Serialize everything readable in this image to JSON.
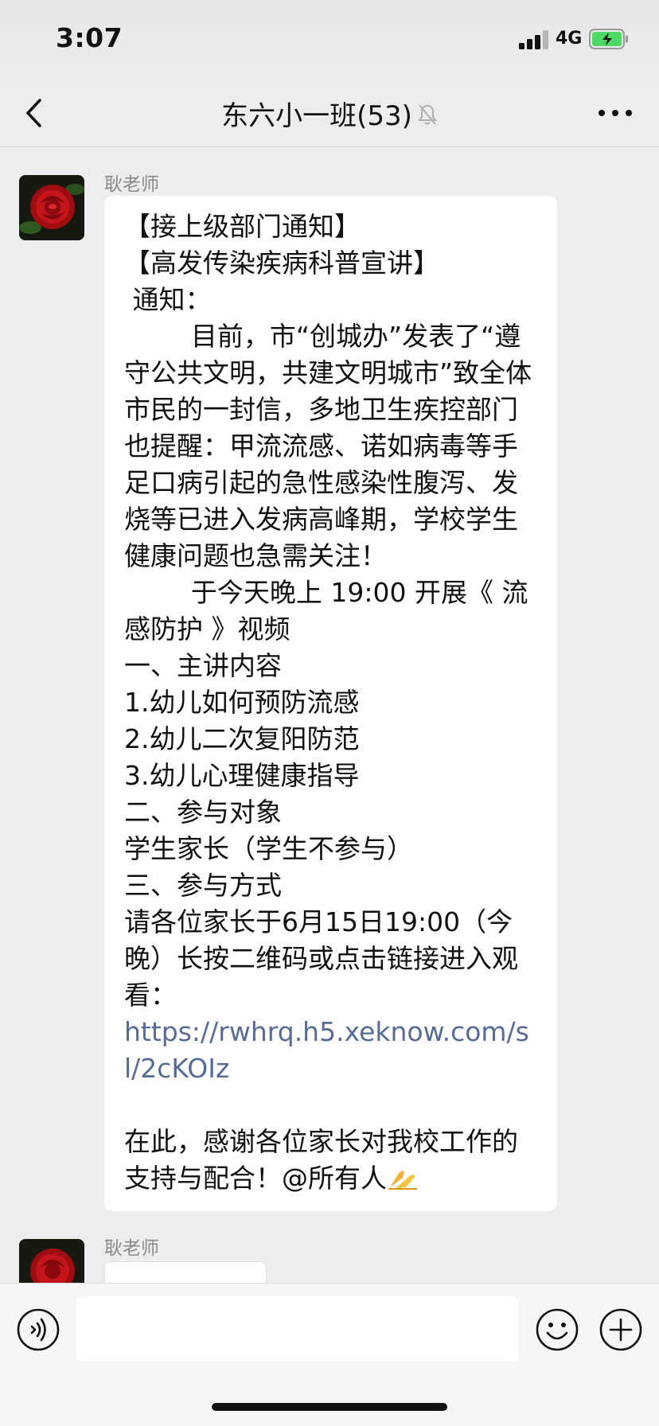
{
  "status_bar": {
    "time": "3:07",
    "network": "4G"
  },
  "nav": {
    "title": "东六小一班(53)"
  },
  "messages": [
    {
      "sender": "耿老师",
      "text_before_link": "【接上级部门通知】\n【高发传染疾病科普宣讲】\n 通知：\n        目前，市“创城办”发表了“遵守公共文明，共建文明城市”致全体市民的一封信，多地卫生疾控部门也提醒：甲流流感、诺如病毒等手足口病引起的急性感染性腹泻、发烧等已进入发病高峰期，学校学生健康问题也急需关注！\n        于今天晚上 19:00 开展《 流感防护 》视频\n一、主讲内容\n1.幼儿如何预防流感\n2.幼儿二次复阳防范\n3.幼儿心理健康指导\n二、参与对象\n学生家长（学生不参与）\n三、参与方式\n请各位家长于6月15日19:00（今晚）长按二维码或点击链接进入观看：\n",
      "link": "https://rwhrq.h5.xeknow.com/sl/2cKOIz",
      "text_after_link": "\n\n在此，感谢各位家长对我校工作的支持与配合！@所有人"
    },
    {
      "sender": "耿老师"
    }
  ],
  "icons": {
    "back": "chevron-left-icon",
    "mute": "bell-muted-icon",
    "more": "ellipsis-icon",
    "voice": "voice-icon",
    "emoji": "smiley-icon",
    "plus": "plus-circle-icon"
  },
  "colors": {
    "link": "#576B95",
    "background": "#EDEDED",
    "bubble": "#FFFFFF",
    "battery": "#4CD964"
  }
}
